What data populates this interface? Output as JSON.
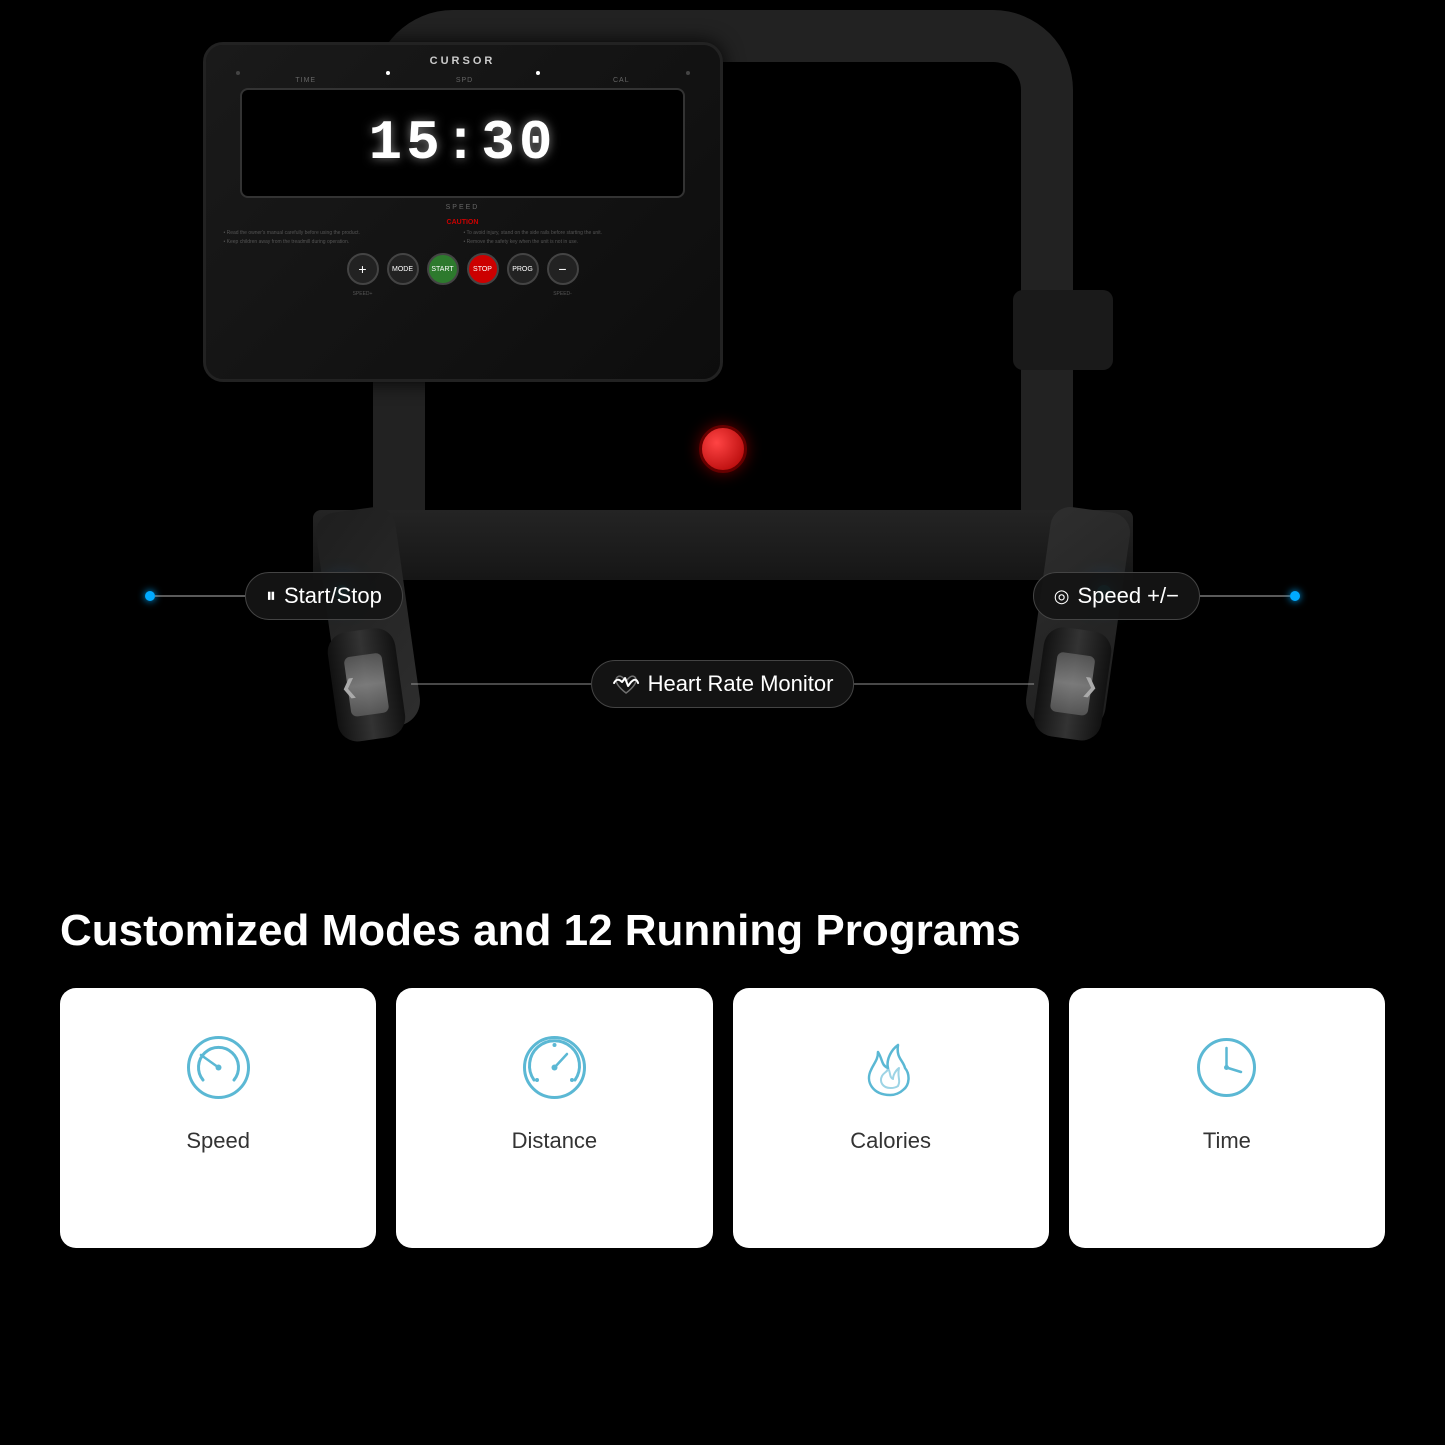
{
  "brand": "CURSOR",
  "display": {
    "time": "15:30",
    "speed_label": "SPEED",
    "labels": [
      "TIME",
      "SPD",
      "CAL"
    ]
  },
  "caution": {
    "title": "CAUTION",
    "lines": [
      "• Read the owner's manual carefully before using the product.",
      "• To avoid injury, stand on the side rails before starting the unit.",
      "• Keep children away from the treadmill during operation.",
      "• Remove the safety key when the unit is not in use."
    ]
  },
  "controls": [
    {
      "id": "plus",
      "label": "+",
      "sublabel": "SPEED+"
    },
    {
      "id": "mode",
      "label": "MODE",
      "sublabel": ""
    },
    {
      "id": "start",
      "label": "START",
      "sublabel": ""
    },
    {
      "id": "stop",
      "label": "STOP",
      "sublabel": ""
    },
    {
      "id": "prog",
      "label": "PROG",
      "sublabel": ""
    },
    {
      "id": "minus",
      "label": "−",
      "sublabel": "SPEED-"
    }
  ],
  "annotations": [
    {
      "id": "start-stop",
      "icon": "⏸",
      "label": "Start/Stop"
    },
    {
      "id": "speed",
      "icon": "◎",
      "label": "Speed +/−"
    },
    {
      "id": "heart-rate",
      "icon": "♡~",
      "label": "Heart Rate Monitor"
    }
  ],
  "section_title": "Customized Modes and 12 Running Programs",
  "cards": [
    {
      "id": "speed",
      "label": "Speed",
      "icon": "speedometer"
    },
    {
      "id": "distance",
      "label": "Distance",
      "icon": "gauge"
    },
    {
      "id": "calories",
      "label": "Calories",
      "icon": "flame"
    },
    {
      "id": "time",
      "label": "Time",
      "icon": "clock"
    }
  ]
}
